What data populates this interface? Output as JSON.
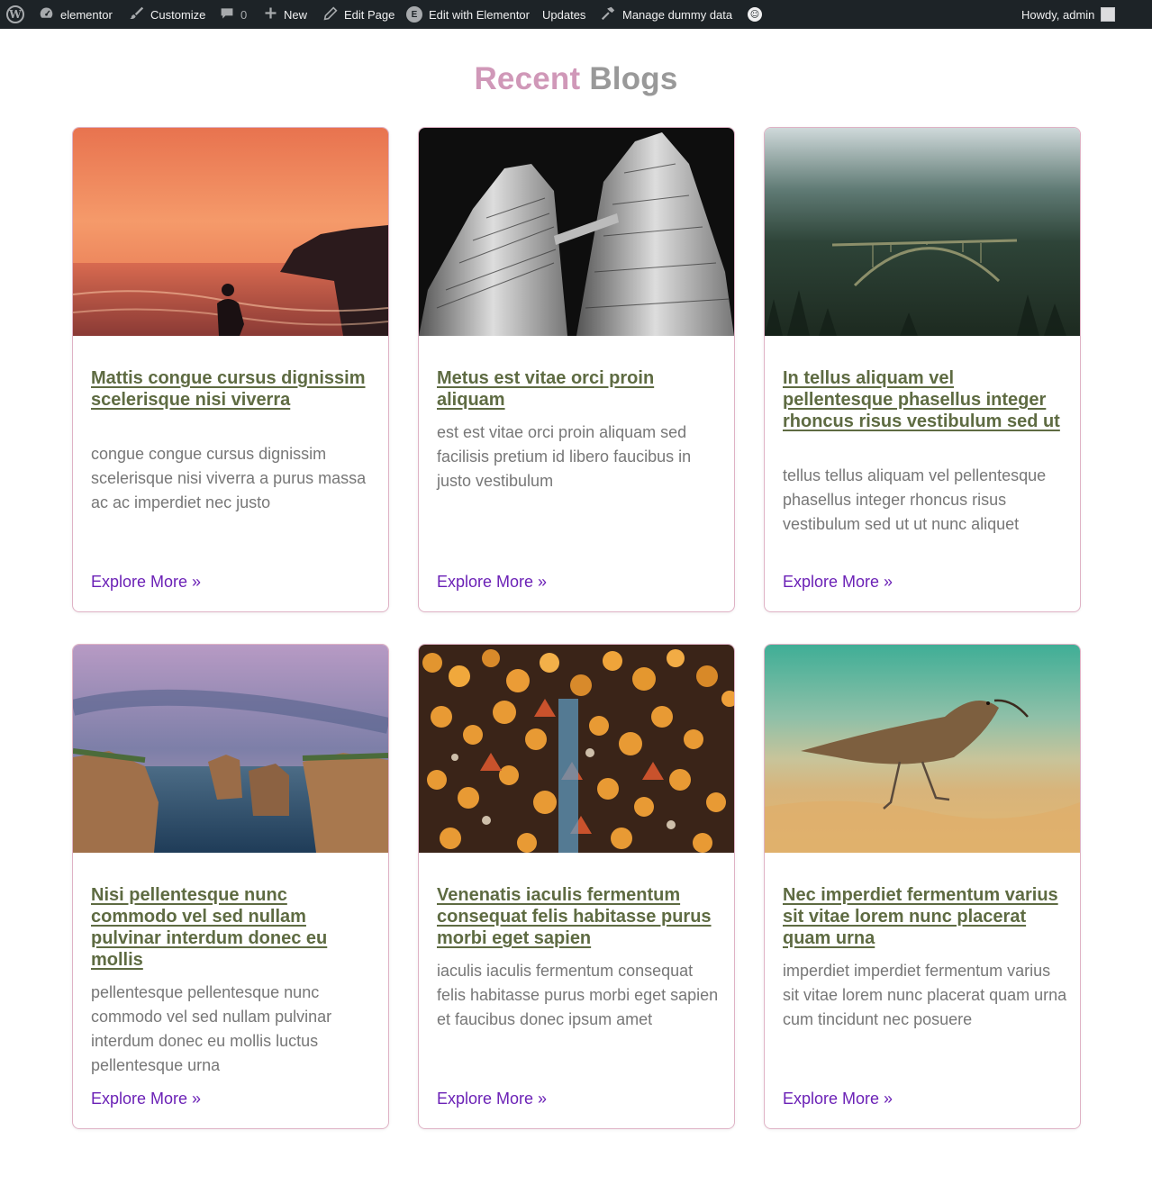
{
  "admin_bar": {
    "site_name": "elementor",
    "customize": "Customize",
    "comments_count": "0",
    "new": "New",
    "edit_page": "Edit Page",
    "edit_elementor": "Edit with Elementor",
    "updates": "Updates",
    "manage_dummy": "Manage dummy data",
    "howdy": "Howdy, admin",
    "colors": {
      "background": "#1d2327",
      "text": "#f0f0f1",
      "icon": "#a7aaad"
    }
  },
  "section": {
    "heading_word1": "Recent",
    "heading_word2": "Blogs",
    "colors": {
      "word1": "#d098b8",
      "word2": "#999999",
      "title": "#5e6b42",
      "excerpt": "#777777",
      "link": "#6b21b6",
      "card_border": "#dfb2c5"
    }
  },
  "posts": [
    {
      "title": "Mattis congue cursus dignissim scelerisque nisi viverra",
      "excerpt": "congue congue cursus dignissim scelerisque nisi viverra a purus massa ac ac imperdiet nec justo",
      "link": "Explore More »",
      "image": "sunset-coast-hiker"
    },
    {
      "title": "Metus est vitae orci proin aliquam",
      "excerpt": "est est vitae orci proin aliquam sed facilisis pretium id libero faucibus in justo vestibulum",
      "link": "Explore More »",
      "image": "twin-towers-bw"
    },
    {
      "title": "In tellus aliquam vel pellentesque phasellus integer rhoncus risus vestibulum sed ut",
      "excerpt": "tellus tellus aliquam vel pellentesque phasellus integer rhoncus risus vestibulum sed ut ut nunc aliquet",
      "link": "Explore More »",
      "image": "forest-bridge-fog"
    },
    {
      "title": "Nisi pellentesque nunc commodo vel sed nullam pulvinar interdum donec eu mollis",
      "excerpt": "pellentesque pellentesque nunc commodo vel sed nullam pulvinar interdum donec eu mollis luctus pellentesque urna",
      "link": "Explore More »",
      "image": "sea-stacks-dusk"
    },
    {
      "title": "Venenatis iaculis fermentum consequat felis habitasse purus morbi eget sapien",
      "excerpt": "iaculis iaculis fermentum consequat felis habitasse purus morbi eget sapien et faucibus donec ipsum amet",
      "link": "Explore More »",
      "image": "market-lanterns"
    },
    {
      "title": "Nec imperdiet fermentum varius sit vitae lorem nunc placerat quam urna",
      "excerpt": "imperdiet imperdiet fermentum varius sit vitae lorem nunc placerat quam urna cum tincidunt nec posuere",
      "link": "Explore More »",
      "image": "curlew-beach"
    }
  ]
}
